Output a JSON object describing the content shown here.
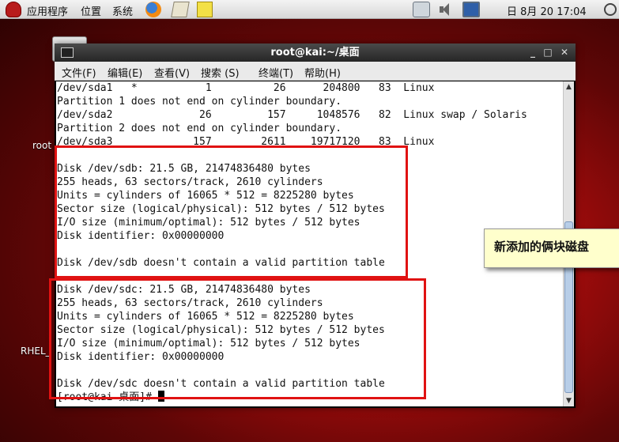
{
  "panel": {
    "apps": "应用程序",
    "places": "位置",
    "system": "系统",
    "clock": "日 8月 20 17:04"
  },
  "desktop": {
    "root_label": "root",
    "rhel_label": "RHEL_"
  },
  "window": {
    "title": "root@kai:~/桌面",
    "minimize": "_",
    "maximize": "□",
    "close": "✕",
    "menus": [
      "文件(F)",
      "编辑(E)",
      "查看(V)",
      "搜索 (S)",
      "终端(T)",
      "帮助(H)"
    ]
  },
  "terminal": {
    "lines": [
      "/dev/sda1   *           1          26      204800   83  Linux",
      "Partition 1 does not end on cylinder boundary.",
      "/dev/sda2              26         157     1048576   82  Linux swap / Solaris",
      "Partition 2 does not end on cylinder boundary.",
      "/dev/sda3             157        2611    19717120   83  Linux",
      "",
      "Disk /dev/sdb: 21.5 GB, 21474836480 bytes",
      "255 heads, 63 sectors/track, 2610 cylinders",
      "Units = cylinders of 16065 * 512 = 8225280 bytes",
      "Sector size (logical/physical): 512 bytes / 512 bytes",
      "I/O size (minimum/optimal): 512 bytes / 512 bytes",
      "Disk identifier: 0x00000000",
      "",
      "Disk /dev/sdb doesn't contain a valid partition table",
      "",
      "Disk /dev/sdc: 21.5 GB, 21474836480 bytes",
      "255 heads, 63 sectors/track, 2610 cylinders",
      "Units = cylinders of 16065 * 512 = 8225280 bytes",
      "Sector size (logical/physical): 512 bytes / 512 bytes",
      "I/O size (minimum/optimal): 512 bytes / 512 bytes",
      "Disk identifier: 0x00000000",
      "",
      "Disk /dev/sdc doesn't contain a valid partition table"
    ],
    "prompt": "[root@kai 桌面]# "
  },
  "annotation": {
    "text": "新添加的俩块磁盘",
    "highlight_color": "#e01212"
  }
}
